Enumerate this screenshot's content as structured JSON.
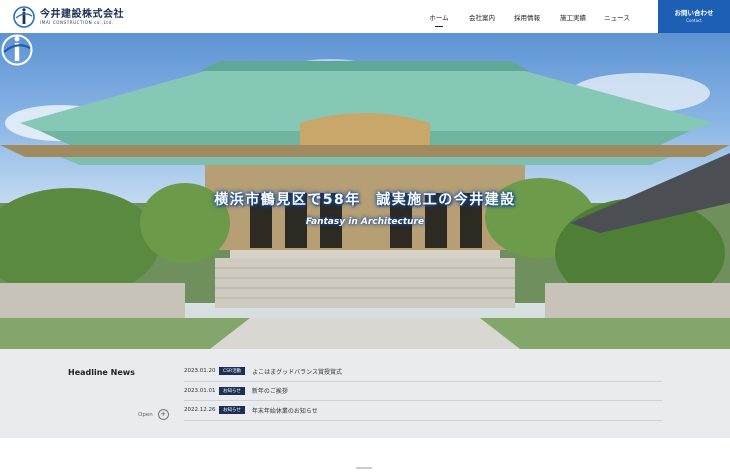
{
  "header": {
    "logo_name": "今井建設株式会社",
    "logo_sub": "IMAI CONSTRUCTION co.,Ltd.",
    "nav": [
      {
        "label": "ホーム",
        "active": true
      },
      {
        "label": "会社案内",
        "active": false
      },
      {
        "label": "採用情報",
        "active": false
      },
      {
        "label": "施工実績",
        "active": false
      },
      {
        "label": "ニュース",
        "active": false
      }
    ],
    "contact_label": "お問い合わせ",
    "contact_sub": "Contact"
  },
  "hero": {
    "title": "横浜市鶴見区で58年　誠実施工の今井建設",
    "subtitle": "Fantasy in Architecture"
  },
  "news": {
    "heading": "Headline News",
    "open_label": "Open",
    "items": [
      {
        "date": "2023.01.20",
        "badge": "CSR活動",
        "text": "よこはまグッドバランス賞授賞式"
      },
      {
        "date": "2023.01.01",
        "badge": "お知らせ",
        "text": "新年のご挨拶"
      },
      {
        "date": "2022.12.26",
        "badge": "お知らせ",
        "text": "年末年始休業のお知らせ"
      }
    ]
  },
  "colors": {
    "brand_navy": "#1b2f57",
    "contact_blue": "#1d5fb4",
    "roof_green": "#7fc2b0"
  }
}
